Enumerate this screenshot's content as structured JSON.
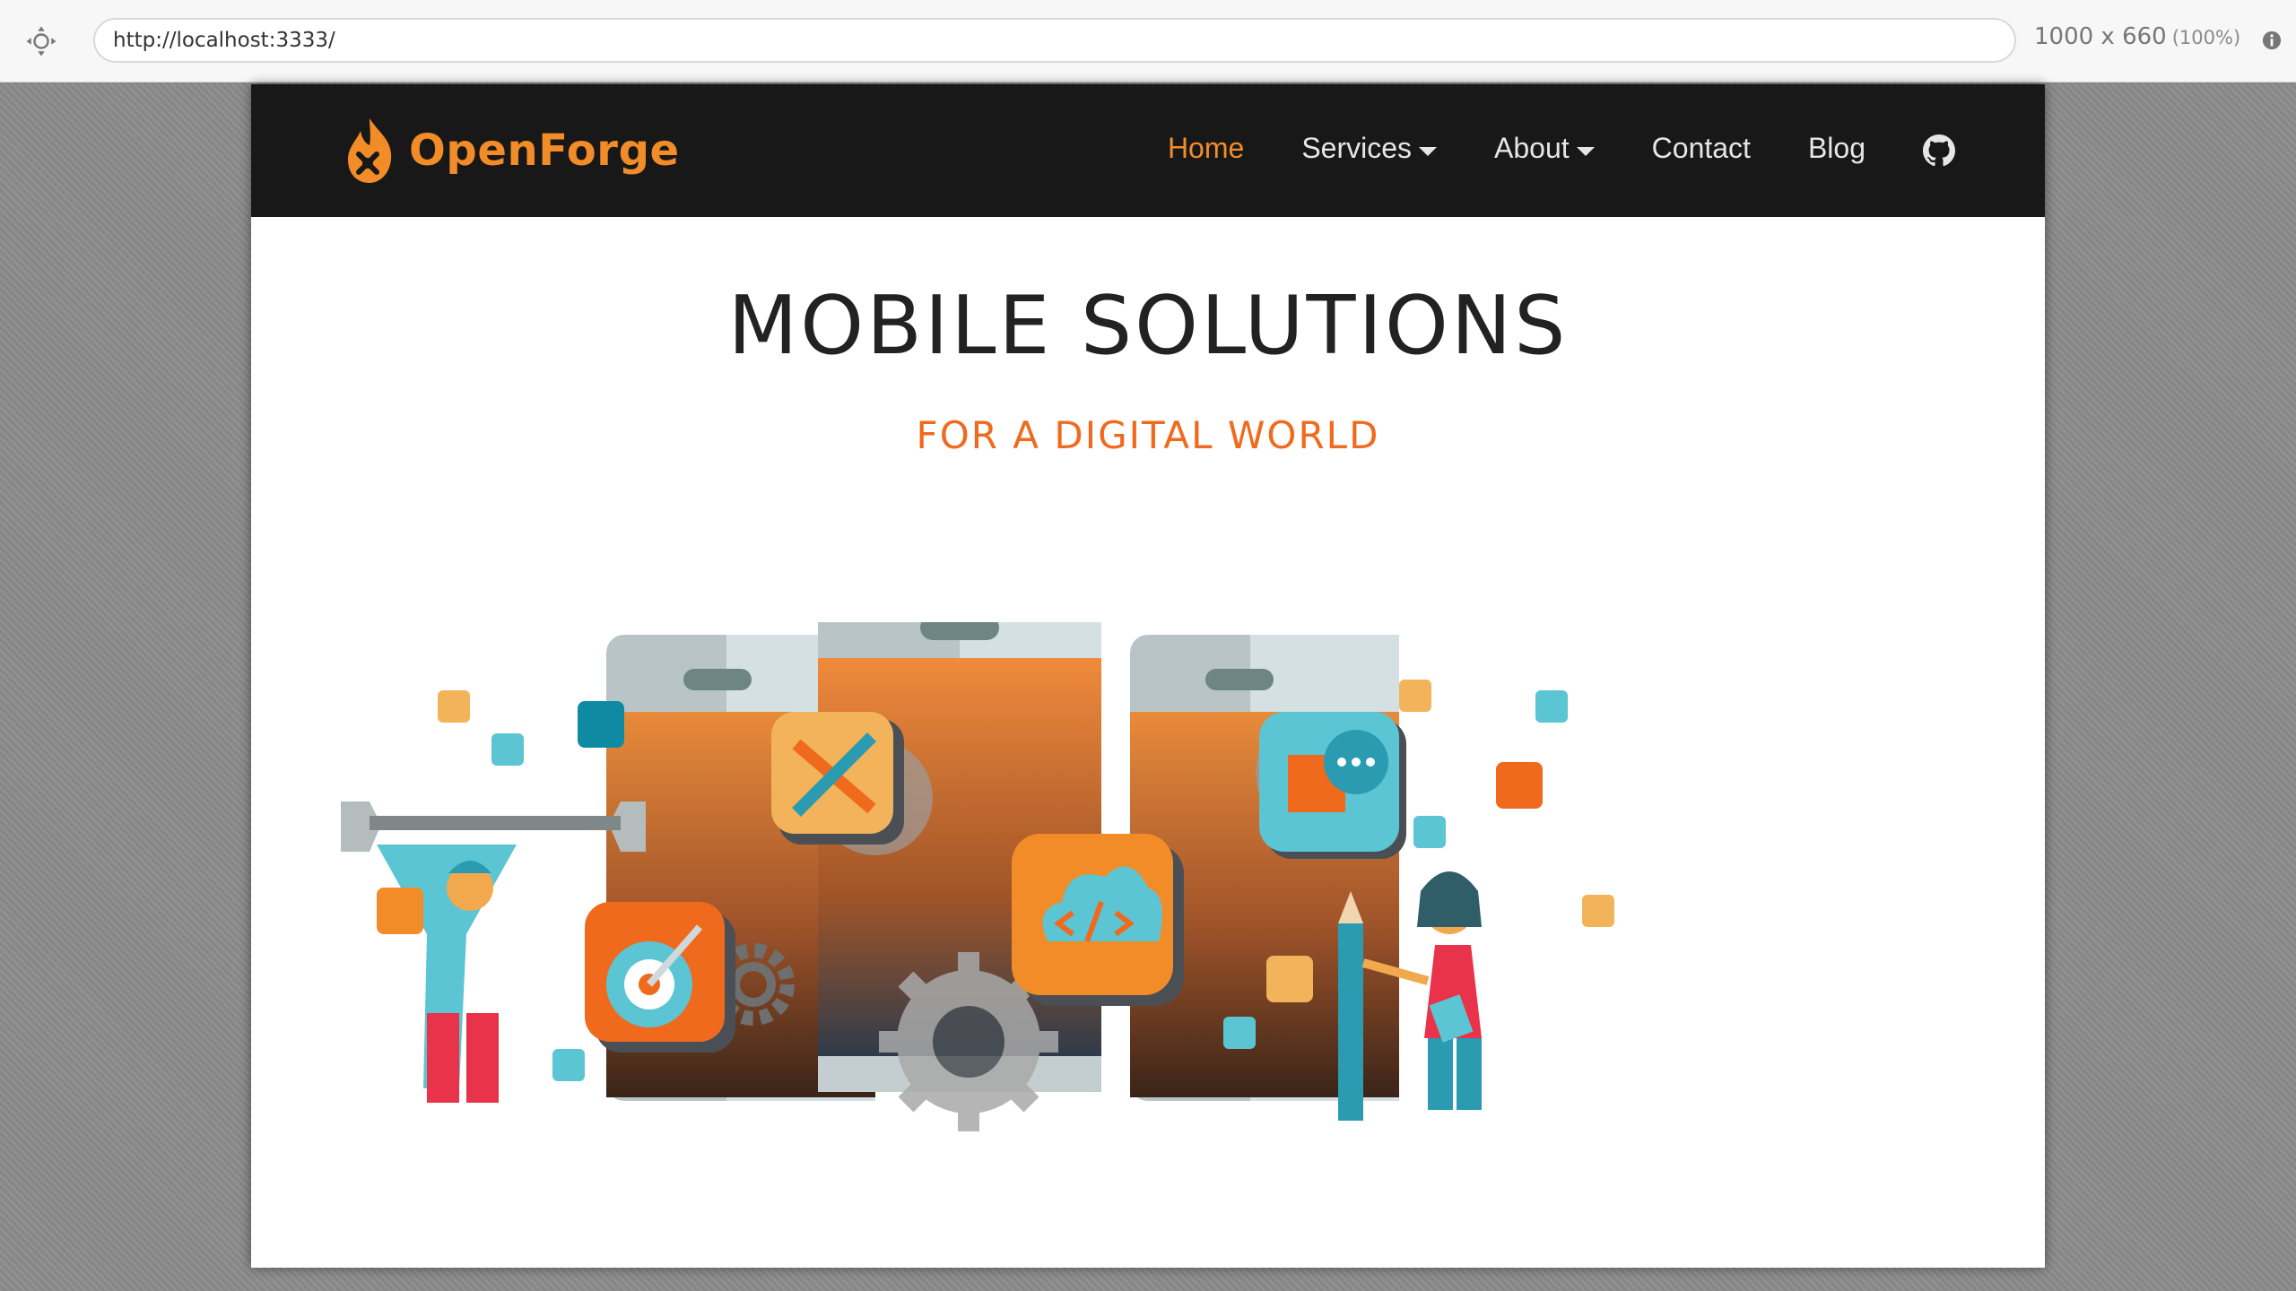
{
  "browser": {
    "url": "http://localhost:3333/",
    "viewport_size": "1000 x 660",
    "zoom": "(100%)"
  },
  "navbar": {
    "brand": "OpenForge",
    "links": [
      {
        "label": "Home",
        "active": true
      },
      {
        "label": "Services",
        "dropdown": true
      },
      {
        "label": "About",
        "dropdown": true
      },
      {
        "label": "Contact"
      },
      {
        "label": "Blog"
      }
    ],
    "github_icon": "github-icon"
  },
  "hero": {
    "title": "MOBILE SOLUTIONS",
    "subtitle": "FOR A DIGITAL WORLD"
  },
  "colors": {
    "brand_orange": "#f28c28",
    "subtitle_orange": "#f06a1e",
    "navbar_bg": "#181818",
    "teal": "#5bc5d3"
  }
}
